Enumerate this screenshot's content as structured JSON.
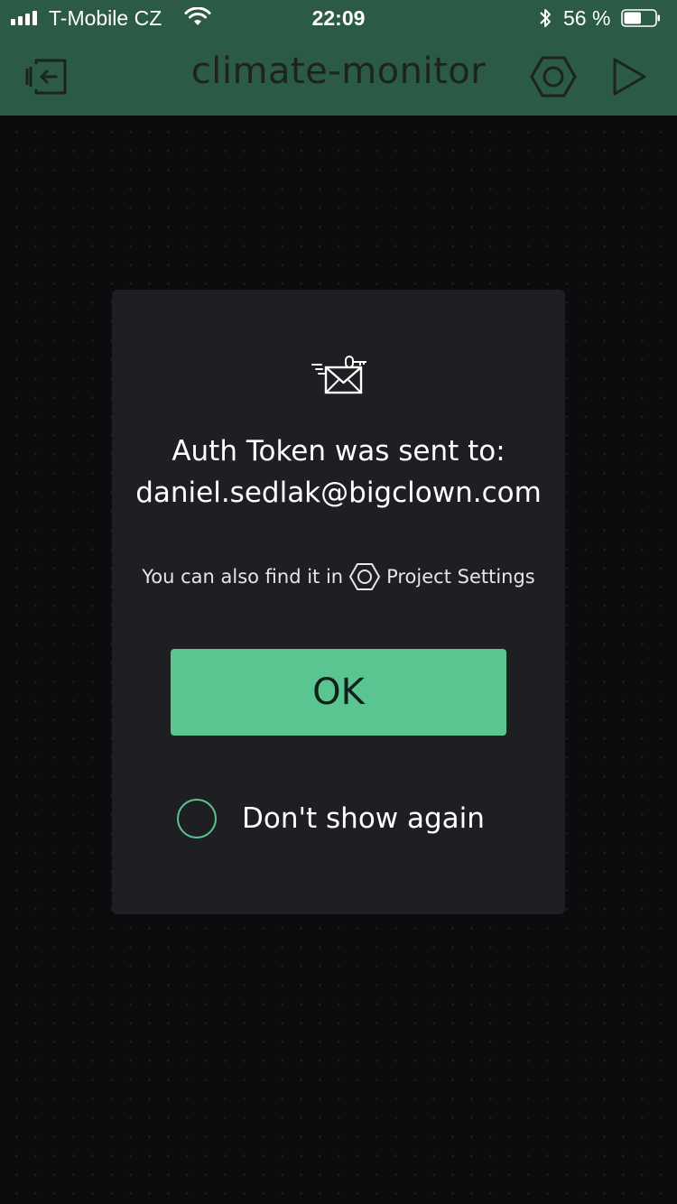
{
  "status_bar": {
    "carrier": "T-Mobile CZ",
    "time": "22:09",
    "battery_percent": "56 %",
    "battery_level": 0.56,
    "signal_bars": 4
  },
  "header": {
    "title": "climate-monitor",
    "back_icon": "exit-project-icon",
    "settings_icon": "hexagon-settings-icon",
    "play_icon": "play-icon"
  },
  "dialog": {
    "icon": "mail-key-icon",
    "title": "Auth Token was sent to:",
    "email": "daniel.sedlak@bigclown.com",
    "hint_prefix": "You can also find it in",
    "hint_icon": "hexagon-settings-icon",
    "hint_suffix": "Project Settings",
    "ok_label": "OK",
    "dont_show_label": "Don't show again",
    "dont_show_checked": false
  },
  "colors": {
    "header_bg": "#2b5a45",
    "accent": "#5bc592",
    "dialog_bg": "#1e1f22",
    "canvas_bg": "#0b0c0e"
  }
}
